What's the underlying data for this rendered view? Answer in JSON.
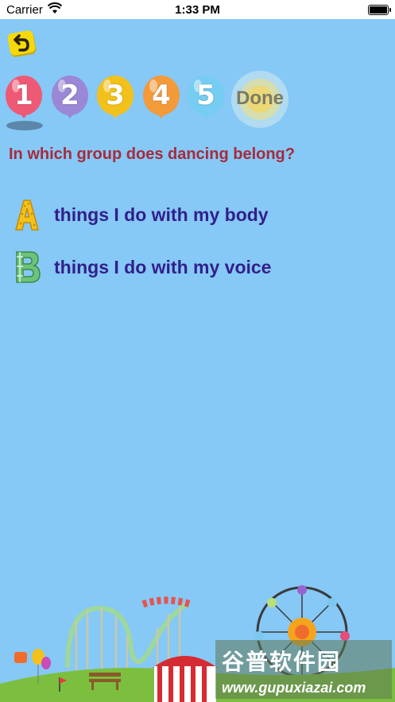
{
  "status_bar": {
    "carrier": "Carrier",
    "time": "1:33 PM"
  },
  "navigation": {
    "back_icon": "back-arrow-icon"
  },
  "steps": {
    "items": [
      {
        "label": "1",
        "color": "#ee5a76"
      },
      {
        "label": "2",
        "color": "#9a88d6"
      },
      {
        "label": "3",
        "color": "#f2c11c"
      },
      {
        "label": "4",
        "color": "#f39a3a"
      },
      {
        "label": "5",
        "color": "#76cdf2"
      }
    ],
    "done_label": "Done"
  },
  "question": "In which group does dancing belong?",
  "answers": [
    {
      "letter": "A",
      "text": "things I do with my body",
      "letter_color": "#f2c11c"
    },
    {
      "letter": "B",
      "text": "things I do with my voice",
      "letter_color": "#6cc37a"
    }
  ],
  "watermark": {
    "line1": "谷普软件园",
    "line2": "www.gupuxiazai.com"
  }
}
